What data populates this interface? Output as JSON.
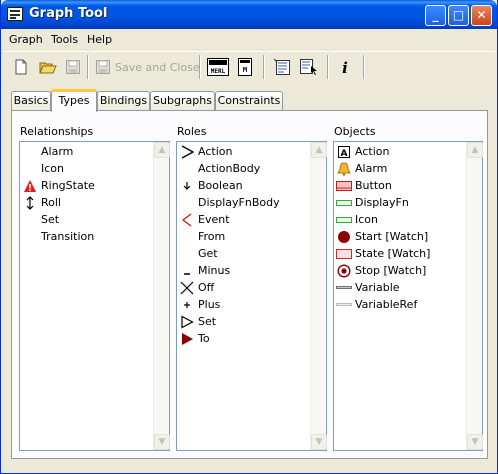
{
  "window": {
    "title": "Graph Tool"
  },
  "titlebar_buttons": {
    "minimize": "_",
    "maximize": "□",
    "close": "✕"
  },
  "menu": [
    {
      "label": "Graph"
    },
    {
      "label": "Tools"
    },
    {
      "label": "Help"
    }
  ],
  "toolbar": {
    "save_close_label": "Save and Close",
    "icons": [
      "new-document-icon",
      "open-folder-icon",
      "save-disk-icon",
      "save-close-icon",
      "merl-icon",
      "mdl-icon",
      "properties-list-icon",
      "select-properties-icon",
      "info-icon"
    ]
  },
  "tabs": [
    {
      "label": "Basics"
    },
    {
      "label": "Types"
    },
    {
      "label": "Bindings"
    },
    {
      "label": "Subgraphs"
    },
    {
      "label": "Constraints"
    }
  ],
  "active_tab": "Types",
  "relationships": {
    "title": "Relationships",
    "items": [
      {
        "label": "Alarm",
        "icon": ""
      },
      {
        "label": "Icon",
        "icon": ""
      },
      {
        "label": "RingState",
        "icon": "warning-triangle-icon"
      },
      {
        "label": "Roll",
        "icon": "double-arrow-icon"
      },
      {
        "label": "Set",
        "icon": ""
      },
      {
        "label": "Transition",
        "icon": ""
      }
    ]
  },
  "roles": {
    "title": "Roles",
    "items": [
      {
        "label": "Action",
        "icon": "chevron-right-icon"
      },
      {
        "label": "ActionBody",
        "icon": ""
      },
      {
        "label": "Boolean",
        "icon": "arrow-down-small-icon"
      },
      {
        "label": "DisplayFnBody",
        "icon": ""
      },
      {
        "label": "Event",
        "icon": "chevron-left-red-icon"
      },
      {
        "label": "From",
        "icon": ""
      },
      {
        "label": "Get",
        "icon": ""
      },
      {
        "label": "Minus",
        "icon": "minus-icon"
      },
      {
        "label": "Off",
        "icon": "cross-icon"
      },
      {
        "label": "Plus",
        "icon": "plus-icon"
      },
      {
        "label": "Set",
        "icon": "triangle-outline-icon"
      },
      {
        "label": "To",
        "icon": "triangle-filled-icon"
      }
    ]
  },
  "objects": {
    "title": "Objects",
    "items": [
      {
        "label": "Action",
        "icon": "letter-a-box-icon"
      },
      {
        "label": "Alarm",
        "icon": "bell-icon"
      },
      {
        "label": "Button",
        "icon": "button-icon"
      },
      {
        "label": "DisplayFn",
        "icon": "green-rect-icon"
      },
      {
        "label": "Icon",
        "icon": "green-rect-icon"
      },
      {
        "label": "Start [Watch]",
        "icon": "filled-circle-icon"
      },
      {
        "label": "State [Watch]",
        "icon": "pink-rect-icon"
      },
      {
        "label": "Stop [Watch]",
        "icon": "target-circle-icon"
      },
      {
        "label": "Variable",
        "icon": "line-icon"
      },
      {
        "label": "VariableRef",
        "icon": "light-line-icon"
      }
    ]
  },
  "colors": {
    "title_bar": "#0054e3",
    "active_tab_accent": "#ffc73c",
    "dark_red": "#8b0000",
    "list_border": "#7f9db9"
  }
}
